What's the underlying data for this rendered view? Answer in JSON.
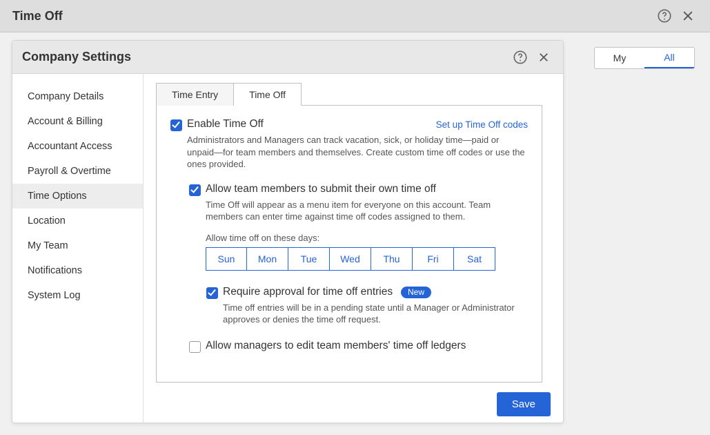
{
  "outer": {
    "title": "Time Off"
  },
  "toggle": {
    "my": "My",
    "all": "All"
  },
  "modal": {
    "title": "Company Settings"
  },
  "sidebar": {
    "items": [
      {
        "label": "Company Details"
      },
      {
        "label": "Account & Billing"
      },
      {
        "label": "Accountant Access"
      },
      {
        "label": "Payroll & Overtime"
      },
      {
        "label": "Time Options"
      },
      {
        "label": "Location"
      },
      {
        "label": "My Team"
      },
      {
        "label": "Notifications"
      },
      {
        "label": "System Log"
      }
    ],
    "active_index": 4
  },
  "tabs": {
    "time_entry": "Time Entry",
    "time_off": "Time Off"
  },
  "setup_link": "Set up Time Off codes",
  "opt_enable": {
    "label": "Enable Time Off",
    "desc": "Administrators and Managers can track vacation, sick, or holiday time—paid or unpaid—for team members and themselves. Create custom time off codes or use the ones provided."
  },
  "opt_allow_submit": {
    "label": "Allow team members to submit their own time off",
    "desc": "Time Off will appear as a menu item for everyone on this account. Team members can enter time against time off codes assigned to them."
  },
  "days_heading": "Allow time off on these days:",
  "days": [
    "Sun",
    "Mon",
    "Tue",
    "Wed",
    "Thu",
    "Fri",
    "Sat"
  ],
  "opt_require_approval": {
    "label": "Require approval for time off entries",
    "badge": "New",
    "desc": "Time off entries will be in a pending state until a Manager or Administrator approves or denies the time off request."
  },
  "opt_manager_edit": {
    "label": "Allow managers to edit team members' time off ledgers"
  },
  "save_label": "Save"
}
